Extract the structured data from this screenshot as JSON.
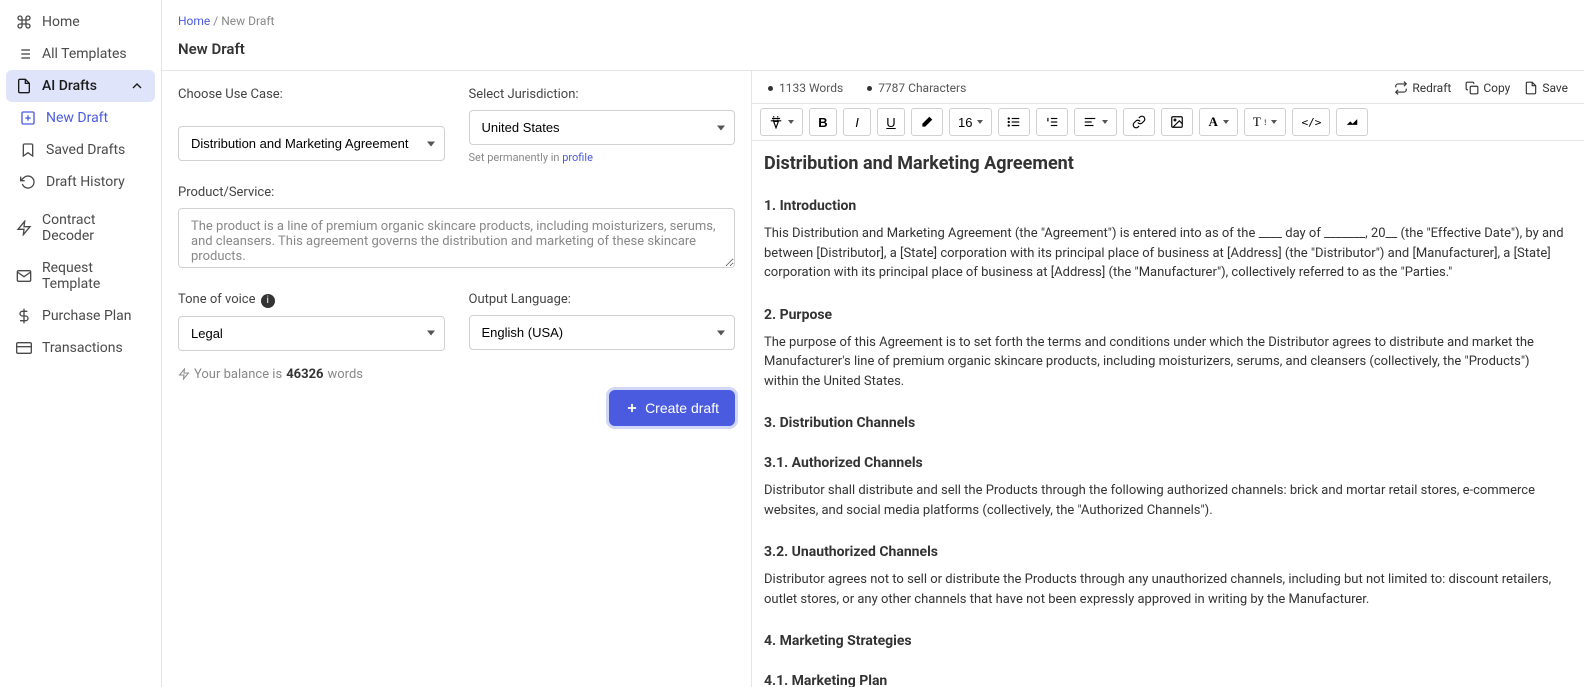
{
  "sidebar": {
    "items": [
      {
        "label": "Home",
        "icon": "command"
      },
      {
        "label": "All Templates",
        "icon": "list"
      },
      {
        "label": "AI Drafts",
        "icon": "file",
        "active": true,
        "expanded": true
      },
      {
        "label": "New Draft",
        "icon": "plus-square",
        "sub": true,
        "highlight": true
      },
      {
        "label": "Saved Drafts",
        "icon": "bookmark",
        "sub": true
      },
      {
        "label": "Draft History",
        "icon": "history",
        "sub": true
      },
      {
        "label": "Contract Decoder",
        "icon": "bolt"
      },
      {
        "label": "Request Template",
        "icon": "mail"
      },
      {
        "label": "Purchase Plan",
        "icon": "dollar"
      },
      {
        "label": "Transactions",
        "icon": "card"
      }
    ]
  },
  "breadcrumb": {
    "home": "Home",
    "sep": "/",
    "current": "New Draft"
  },
  "page_title": "New Draft",
  "form": {
    "usecase": {
      "label": "Choose Use Case:",
      "value": "Distribution and Marketing Agreement"
    },
    "jurisdiction": {
      "label": "Select Jurisdiction:",
      "value": "United States",
      "helper_prefix": "Set permanently in ",
      "helper_link": "profile"
    },
    "product": {
      "label": "Product/Service:",
      "value": "The product is a line of premium organic skincare products, including moisturizers, serums, and cleansers. This agreement governs the distribution and marketing of these skincare products."
    },
    "tone": {
      "label": "Tone of voice",
      "value": "Legal"
    },
    "language": {
      "label": "Output Language:",
      "value": "English (USA)"
    },
    "balance_prefix": "Your balance is ",
    "balance_value": "46326",
    "balance_suffix": " words",
    "create_btn": "Create draft"
  },
  "editor": {
    "words": "1133 Words",
    "chars": "7787 Characters",
    "actions": {
      "redraft": "Redraft",
      "copy": "Copy",
      "save": "Save"
    },
    "fontsize": "16"
  },
  "document": {
    "title": "Distribution and Marketing Agreement",
    "sections": [
      {
        "h": "1. Introduction",
        "p": "This Distribution and Marketing Agreement (the \"Agreement\") is entered into as of the ____ day of _______, 20__ (the \"Effective Date\"), by and between [Distributor], a [State] corporation with its principal place of business at [Address] (the \"Distributor\") and [Manufacturer], a [State] corporation with its principal place of business at [Address] (the \"Manufacturer\"), collectively referred to as the \"Parties.\""
      },
      {
        "h": "2. Purpose",
        "p": "The purpose of this Agreement is to set forth the terms and conditions under which the Distributor agrees to distribute and market the Manufacturer's line of premium organic skincare products, including moisturizers, serums, and cleansers (collectively, the \"Products\") within the United States."
      },
      {
        "h": "3. Distribution Channels",
        "p": ""
      },
      {
        "h": "3.1. Authorized Channels",
        "p": "Distributor shall distribute and sell the Products through the following authorized channels: brick and mortar retail stores, e-commerce websites, and social media platforms (collectively, the \"Authorized Channels\")."
      },
      {
        "h": "3.2. Unauthorized Channels",
        "p": "Distributor agrees not to sell or distribute the Products through any unauthorized channels, including but not limited to: discount retailers, outlet stores, or any other channels that have not been expressly approved in writing by the Manufacturer."
      },
      {
        "h": "4. Marketing Strategies",
        "p": ""
      },
      {
        "h": "4.1. Marketing Plan",
        "p": ""
      }
    ]
  }
}
